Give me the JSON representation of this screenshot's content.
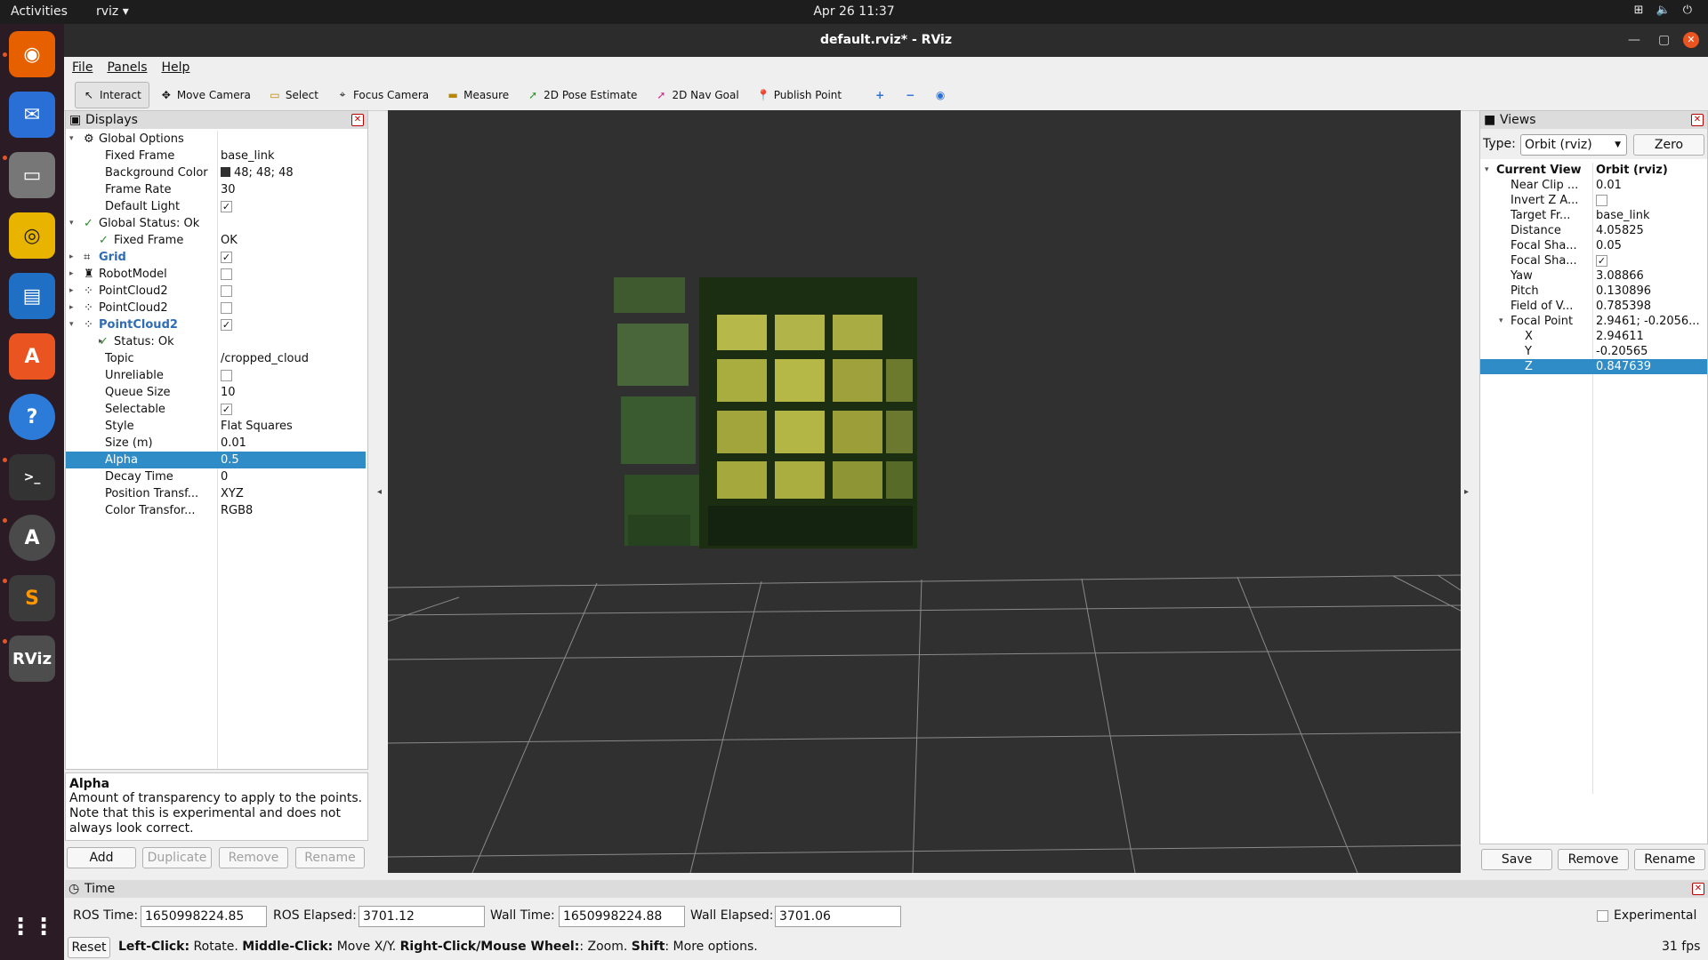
{
  "topbar": {
    "activities": "Activities",
    "app_menu": "rviz ▾",
    "clock": "Apr 26  11:37"
  },
  "window": {
    "title": "default.rviz* - RViz"
  },
  "menu": {
    "file": "File",
    "panels": "Panels",
    "help": "Help"
  },
  "toolbar": {
    "interact": "Interact",
    "move_camera": "Move Camera",
    "select": "Select",
    "focus_camera": "Focus Camera",
    "measure": "Measure",
    "pose_estimate": "2D Pose Estimate",
    "nav_goal": "2D Nav Goal",
    "publish_point": "Publish Point"
  },
  "displays": {
    "title": "Displays",
    "rows": [
      {
        "key": "Global Options",
        "val": ""
      },
      {
        "key": "Fixed Frame",
        "val": "base_link"
      },
      {
        "key": "Background Color",
        "val": "48; 48; 48"
      },
      {
        "key": "Frame Rate",
        "val": "30"
      },
      {
        "key": "Default Light",
        "val": ""
      },
      {
        "key": "Global Status: Ok",
        "val": ""
      },
      {
        "key": "Fixed Frame",
        "val": "OK"
      },
      {
        "key": "Grid",
        "val": ""
      },
      {
        "key": "RobotModel",
        "val": ""
      },
      {
        "key": "PointCloud2",
        "val": ""
      },
      {
        "key": "PointCloud2",
        "val": ""
      },
      {
        "key": "PointCloud2",
        "val": ""
      },
      {
        "key": "Status: Ok",
        "val": ""
      },
      {
        "key": "Topic",
        "val": "/cropped_cloud"
      },
      {
        "key": "Unreliable",
        "val": ""
      },
      {
        "key": "Queue Size",
        "val": "10"
      },
      {
        "key": "Selectable",
        "val": ""
      },
      {
        "key": "Style",
        "val": "Flat Squares"
      },
      {
        "key": "Size (m)",
        "val": "0.01"
      },
      {
        "key": "Alpha",
        "val": "0.5"
      },
      {
        "key": "Decay Time",
        "val": "0"
      },
      {
        "key": "Position Transf...",
        "val": "XYZ"
      },
      {
        "key": "Color Transfor...",
        "val": "RGB8"
      }
    ],
    "help_title": "Alpha",
    "help_text": "Amount of transparency to apply to the points. Note that this is experimental and does not always look correct.",
    "buttons": {
      "add": "Add",
      "duplicate": "Duplicate",
      "remove": "Remove",
      "rename": "Rename"
    }
  },
  "views": {
    "title": "Views",
    "type_label": "Type:",
    "type_value": "Orbit (rviz)",
    "zero": "Zero",
    "rows": [
      {
        "key": "Current View",
        "val": "Orbit (rviz)"
      },
      {
        "key": "Near Clip ...",
        "val": "0.01"
      },
      {
        "key": "Invert Z A...",
        "val": ""
      },
      {
        "key": "Target Fr...",
        "val": "base_link"
      },
      {
        "key": "Distance",
        "val": "4.05825"
      },
      {
        "key": "Focal Sha...",
        "val": "0.05"
      },
      {
        "key": "Focal Sha...",
        "val": ""
      },
      {
        "key": "Yaw",
        "val": "3.08866"
      },
      {
        "key": "Pitch",
        "val": "0.130896"
      },
      {
        "key": "Field of V...",
        "val": "0.785398"
      },
      {
        "key": "Focal Point",
        "val": "2.9461; -0.2056..."
      },
      {
        "key": "X",
        "val": "2.94611"
      },
      {
        "key": "Y",
        "val": "-0.20565"
      },
      {
        "key": "Z",
        "val": "0.847639"
      }
    ],
    "buttons": {
      "save": "Save",
      "remove": "Remove",
      "rename": "Rename"
    }
  },
  "time": {
    "title": "Time",
    "ros_time_label": "ROS Time:",
    "ros_time": "1650998224.85",
    "ros_elapsed_label": "ROS Elapsed:",
    "ros_elapsed": "3701.12",
    "wall_time_label": "Wall Time:",
    "wall_time": "1650998224.88",
    "wall_elapsed_label": "Wall Elapsed:",
    "wall_elapsed": "3701.06",
    "experimental": "Experimental"
  },
  "status": {
    "reset": "Reset",
    "hint_b1": "Left-Click:",
    "hint_t1": " Rotate. ",
    "hint_b2": "Middle-Click:",
    "hint_t2": " Move X/Y. ",
    "hint_b3": "Right-Click/Mouse Wheel:",
    "hint_t3": ": Zoom. ",
    "hint_b4": "Shift",
    "hint_t4": ": More options.",
    "fps": "31 fps"
  },
  "colors": {
    "background": "#303030",
    "selection": "#308cc6",
    "accent": "#e95420"
  }
}
